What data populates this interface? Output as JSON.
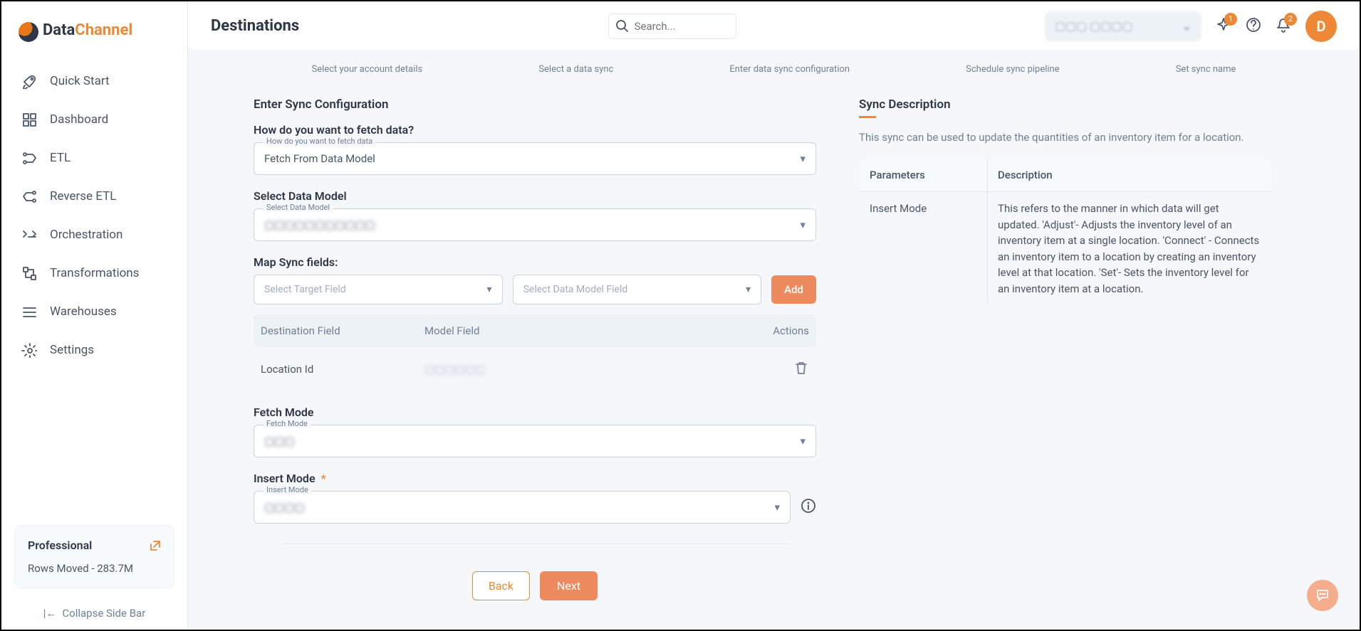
{
  "brand": {
    "part1": "Data",
    "part2": "Channel"
  },
  "sidebar": {
    "items": [
      {
        "label": "Quick Start"
      },
      {
        "label": "Dashboard"
      },
      {
        "label": "ETL"
      },
      {
        "label": "Reverse ETL"
      },
      {
        "label": "Orchestration"
      },
      {
        "label": "Transformations"
      },
      {
        "label": "Warehouses"
      },
      {
        "label": "Settings"
      }
    ],
    "plan_title": "Professional",
    "plan_stat": "Rows Moved - 283.7M",
    "collapse": "Collapse Side Bar"
  },
  "header": {
    "title": "Destinations",
    "search_placeholder": "Search...",
    "account": "▢▢▢  ▢▢▢▢",
    "sparkle_badge": "1",
    "bell_badge": "2",
    "avatar": "D"
  },
  "steps": [
    "Select your account details",
    "Select a data sync",
    "Enter data sync configuration",
    "Schedule sync pipeline",
    "Set sync name"
  ],
  "form": {
    "section_title": "Enter Sync Configuration",
    "fetch_q": "How do you want to fetch data?",
    "fetch_float": "How do you want to fetch data",
    "fetch_value": "Fetch From Data Model",
    "data_model_label": "Select Data Model",
    "data_model_float": "Select Data Model",
    "data_model_value": "▢▢▢▢▢▢▢▢▢▢▢",
    "map_title": "Map Sync fields:",
    "target_ph": "Select Target Field",
    "model_ph": "Select Data Model Field",
    "add": "Add",
    "th_dest": "Destination Field",
    "th_model": "Model Field",
    "th_actions": "Actions",
    "row_dest": "Location Id",
    "row_model": "▢▢▢▢▢▢",
    "fetch_mode_label": "Fetch Mode",
    "fetch_mode_float": "Fetch Mode",
    "fetch_mode_value": "▢▢▢",
    "insert_mode_label": "Insert Mode",
    "insert_mode_float": "Insert Mode",
    "insert_mode_value": "▢▢▢▢",
    "back": "Back",
    "next": "Next"
  },
  "desc": {
    "title": "Sync Description",
    "text": "This sync can be used to update the quantities of an inventory item for a location.",
    "th_param": "Parameters",
    "th_desc": "Description",
    "row_param": "Insert Mode",
    "row_desc": "This refers to the manner in which data will get updated. 'Adjust'- Adjusts the inventory level of an inventory item at a single location. 'Connect' - Connects an inventory item to a location by creating an inventory level at that location. 'Set'- Sets the inventory level for an inventory item at a location."
  }
}
